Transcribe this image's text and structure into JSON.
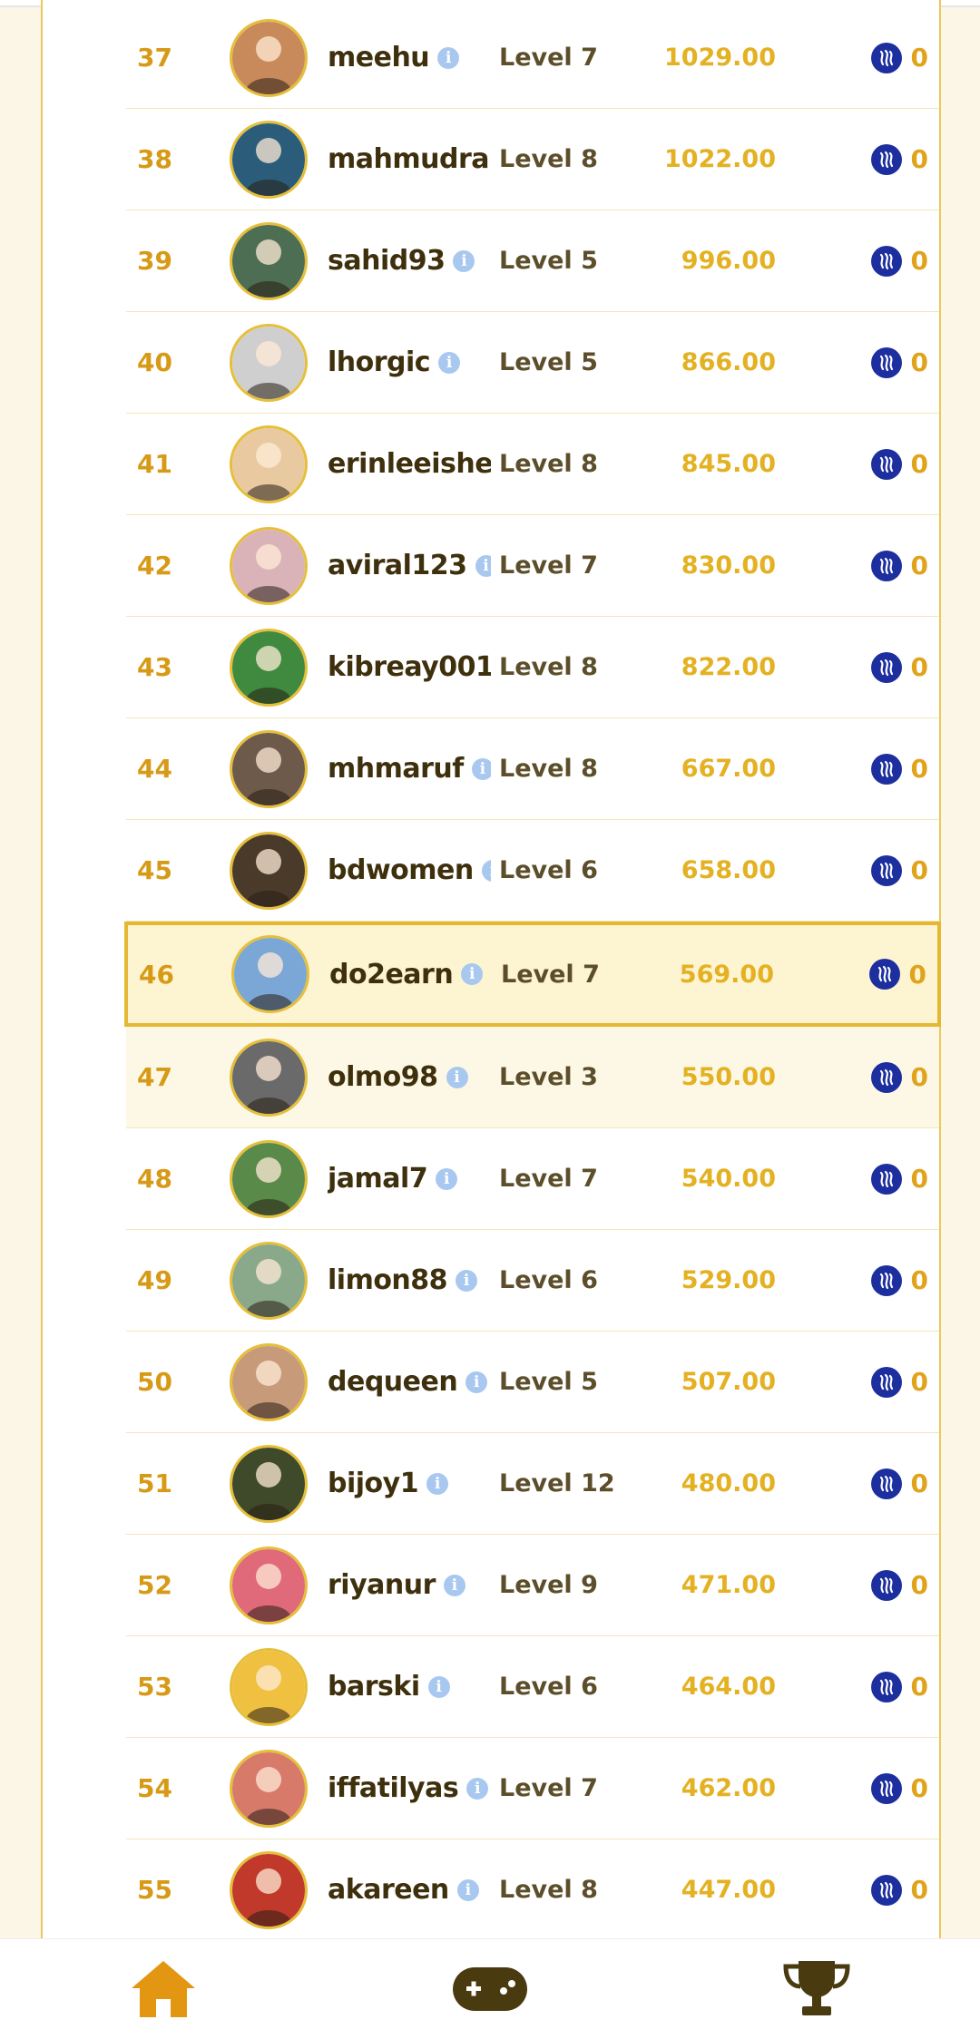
{
  "colors": {
    "rank": "#d79a16",
    "points": "#e3b122",
    "level": "#5c4e2a",
    "username": "#3f300d",
    "highlight_border": "#e5b831",
    "steem_icon": "#1d2f9e",
    "nav_home": "#e39612",
    "nav_dark": "#4a3a10"
  },
  "leaderboard": {
    "rows": [
      {
        "rank": "37",
        "username": "meehu",
        "level": "Level 7",
        "points": "1029.00",
        "reward": "0",
        "avatar_color": "#c98a5b"
      },
      {
        "rank": "38",
        "username": "mahmudrahman",
        "level": "Level 8",
        "points": "1022.00",
        "reward": "0",
        "avatar_color": "#2b5d7a"
      },
      {
        "rank": "39",
        "username": "sahid93",
        "level": "Level 5",
        "points": "996.00",
        "reward": "0",
        "avatar_color": "#4d6e52"
      },
      {
        "rank": "40",
        "username": "lhorgic",
        "level": "Level 5",
        "points": "866.00",
        "reward": "0",
        "avatar_color": "#cfcfcf"
      },
      {
        "rank": "41",
        "username": "erinleeishere",
        "level": "Level 8",
        "points": "845.00",
        "reward": "0",
        "avatar_color": "#e8c9a0"
      },
      {
        "rank": "42",
        "username": "aviral123",
        "level": "Level 7",
        "points": "830.00",
        "reward": "0",
        "avatar_color": "#d9b3b8"
      },
      {
        "rank": "43",
        "username": "kibreay001",
        "level": "Level 8",
        "points": "822.00",
        "reward": "0",
        "avatar_color": "#3f8a3e"
      },
      {
        "rank": "44",
        "username": "mhmaruf",
        "level": "Level 8",
        "points": "667.00",
        "reward": "0",
        "avatar_color": "#6d5a4a"
      },
      {
        "rank": "45",
        "username": "bdwomen",
        "level": "Level 6",
        "points": "658.00",
        "reward": "0",
        "avatar_color": "#4a3a2a"
      },
      {
        "rank": "46",
        "username": "do2earn",
        "level": "Level 7",
        "points": "569.00",
        "reward": "0",
        "avatar_color": "#7aa7d6",
        "current_user": true
      },
      {
        "rank": "47",
        "username": "olmo98",
        "level": "Level 3",
        "points": "550.00",
        "reward": "0",
        "avatar_color": "#6a6a6a"
      },
      {
        "rank": "48",
        "username": "jamal7",
        "level": "Level 7",
        "points": "540.00",
        "reward": "0",
        "avatar_color": "#5a8a4a"
      },
      {
        "rank": "49",
        "username": "limon88",
        "level": "Level 6",
        "points": "529.00",
        "reward": "0",
        "avatar_color": "#8aa88a"
      },
      {
        "rank": "50",
        "username": "dequeen",
        "level": "Level 5",
        "points": "507.00",
        "reward": "0",
        "avatar_color": "#c79a7a"
      },
      {
        "rank": "51",
        "username": "bijoy1",
        "level": "Level 12",
        "points": "480.00",
        "reward": "0",
        "avatar_color": "#3f4a2a"
      },
      {
        "rank": "52",
        "username": "riyanur",
        "level": "Level 9",
        "points": "471.00",
        "reward": "0",
        "avatar_color": "#e06a7a"
      },
      {
        "rank": "53",
        "username": "barski",
        "level": "Level 6",
        "points": "464.00",
        "reward": "0",
        "avatar_color": "#f0c040"
      },
      {
        "rank": "54",
        "username": "iffatilyas",
        "level": "Level 7",
        "points": "462.00",
        "reward": "0",
        "avatar_color": "#d87a6a"
      },
      {
        "rank": "55",
        "username": "akareen",
        "level": "Level 8",
        "points": "447.00",
        "reward": "0",
        "avatar_color": "#c0392b"
      }
    ]
  },
  "nav": {
    "items": [
      {
        "icon": "home-icon"
      },
      {
        "icon": "gamepad-icon"
      },
      {
        "icon": "trophy-icon"
      }
    ]
  }
}
